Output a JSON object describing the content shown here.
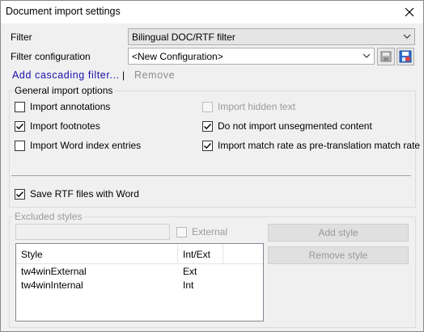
{
  "window": {
    "title": "Document import settings",
    "close_icon": "close-icon"
  },
  "filter": {
    "label": "Filter",
    "value": "Bilingual DOC/RTF filter"
  },
  "filter_configuration": {
    "label": "Filter configuration",
    "value": "<New Configuration>",
    "icons": [
      "save-config-icon",
      "config-settings-icon"
    ]
  },
  "links": {
    "add_cascading": "Add cascading filter...",
    "separator": "|",
    "remove": "Remove"
  },
  "general_options": {
    "title": "General import options",
    "import_annotations": {
      "label": "Import annotations",
      "checked": false
    },
    "import_footnotes": {
      "label": "Import footnotes",
      "checked": true
    },
    "import_word_index": {
      "label": "Import Word index entries",
      "checked": false
    },
    "import_hidden_text": {
      "label": "Import hidden text",
      "checked": false,
      "disabled": true
    },
    "do_not_import_unsegmented": {
      "label": "Do not import unsegmented content",
      "checked": true
    },
    "import_match_rate": {
      "label": "Import match rate as pre-translation match rate",
      "checked": true
    },
    "save_rtf_with_word": {
      "label": "Save RTF files with Word",
      "checked": true
    }
  },
  "excluded_styles": {
    "title": "Excluded styles",
    "style_input": "",
    "external": {
      "label": "External",
      "checked": false,
      "disabled": true
    },
    "add_style_button": "Add style",
    "remove_style_button": "Remove style",
    "columns": [
      "Style",
      "Int/Ext"
    ],
    "rows": [
      {
        "style": "tw4winExternal",
        "type": "Ext"
      },
      {
        "style": "tw4winInternal",
        "type": "Int"
      }
    ]
  },
  "colors": {
    "window_bg": "#f0f0f0",
    "link": "#1a0dab",
    "disabled_text": "#9a9a9a"
  }
}
